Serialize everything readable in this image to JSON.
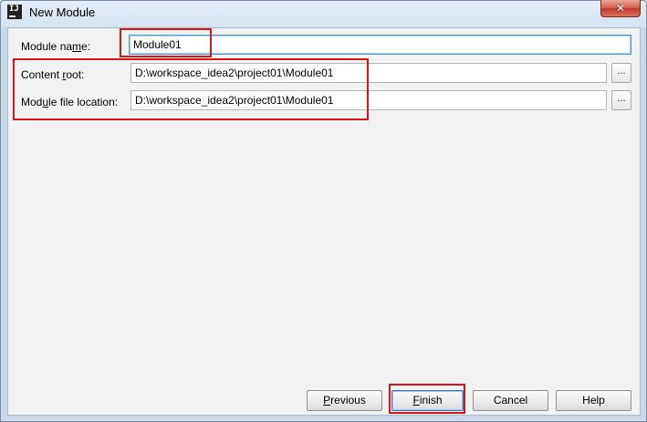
{
  "window": {
    "title": "New Module",
    "app_icon_text": "IJ"
  },
  "form": {
    "module_name": {
      "label_pre": "Module na",
      "label_mnemonic": "m",
      "label_post": "e:",
      "value": "Module01"
    },
    "content_root": {
      "label_pre": "Content ",
      "label_mnemonic": "r",
      "label_post": "oot:",
      "value": "D:\\workspace_idea2\\project01\\Module01",
      "browse_label": "..."
    },
    "module_file_location": {
      "label_pre": "Mod",
      "label_mnemonic": "u",
      "label_post": "le file location:",
      "value": "D:\\workspace_idea2\\project01\\Module01",
      "browse_label": "..."
    }
  },
  "buttons": {
    "previous": {
      "mnemonic": "P",
      "rest": "revious"
    },
    "finish": {
      "mnemonic": "F",
      "rest": "inish"
    },
    "cancel": {
      "label": "Cancel"
    },
    "help": {
      "label": "Help"
    }
  },
  "annotation_color": "#d6161b",
  "close_icon": "close-icon"
}
